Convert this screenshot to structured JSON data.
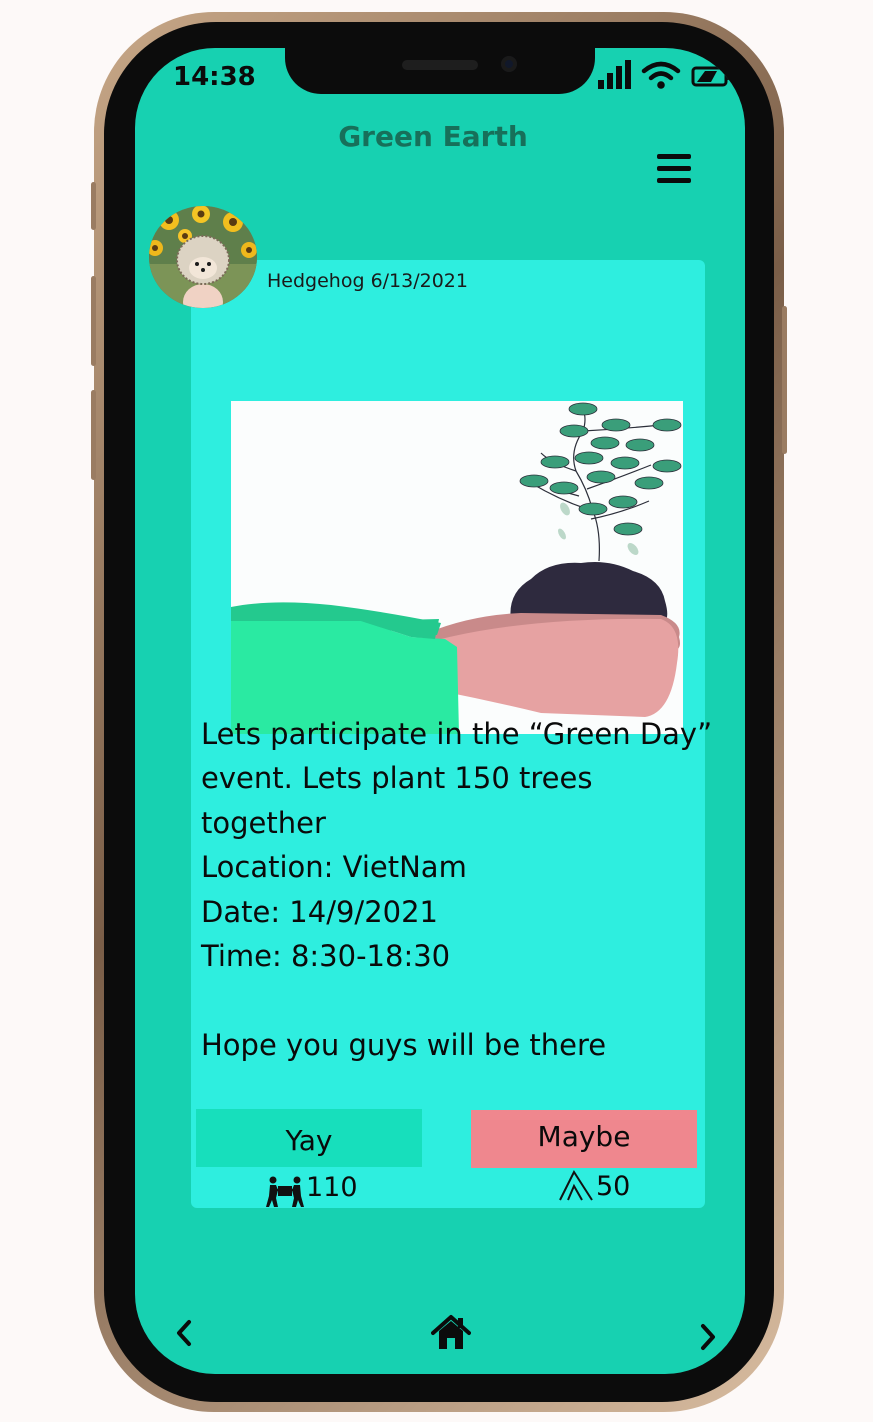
{
  "status_bar": {
    "time": "14:38"
  },
  "header": {
    "title": "Green Earth"
  },
  "post": {
    "author": "Hedgehog",
    "date": "6/13/2021",
    "lines": [
      "Lets participate in the “Green Day”",
      "event. Lets plant 150 trees",
      "together",
      "Location: VietNam",
      "Date: 14/9/2021",
      "Time: 8:30-18:30",
      "",
      "Hope you guys will be there"
    ]
  },
  "actions": {
    "yay_label": "Yay",
    "yay_count": "110",
    "maybe_label": "Maybe",
    "maybe_count": "50"
  },
  "icons": {
    "status": [
      "signal-icon",
      "wifi-icon",
      "battery-icon"
    ],
    "menu": "hamburger-menu-icon",
    "yay_count": "people-carrying-box-icon",
    "maybe_count": "double-chevron-up-icon",
    "nav": [
      "chevron-left-icon",
      "home-icon",
      "chevron-right-icon"
    ]
  },
  "colors": {
    "screen_bg": "#17d1b1",
    "card_bg": "#2eeedf",
    "title": "#17705a",
    "yay_button": "#17dfbc",
    "maybe_button": "#ef878e"
  }
}
